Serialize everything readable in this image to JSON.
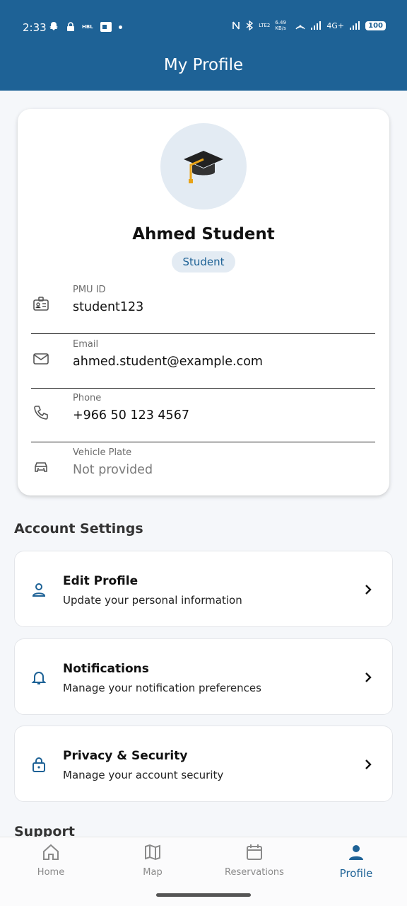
{
  "status_bar": {
    "time": "2:33",
    "network_speed": "6.49 KB/s",
    "network_type": "4G+",
    "volte": "LTE2",
    "battery": "100",
    "carrier_badge": "HBL"
  },
  "app_bar": {
    "title": "My Profile"
  },
  "profile": {
    "name": "Ahmed Student",
    "role": "Student",
    "avatar_icon": "graduation-cap-icon",
    "fields": [
      {
        "label": "PMU ID",
        "value": "student123",
        "icon": "id-card-icon"
      },
      {
        "label": "Email",
        "value": "ahmed.student@example.com",
        "icon": "mail-icon"
      },
      {
        "label": "Phone",
        "value": "+966 50 123 4567",
        "icon": "phone-icon"
      },
      {
        "label": "Vehicle Plate",
        "value": "Not provided",
        "icon": "car-icon"
      }
    ]
  },
  "account_settings": {
    "title": "Account Settings",
    "items": [
      {
        "title": "Edit Profile",
        "subtitle": "Update your personal information",
        "icon": "user-icon"
      },
      {
        "title": "Notifications",
        "subtitle": "Manage your notification preferences",
        "icon": "bell-icon"
      },
      {
        "title": "Privacy & Security",
        "subtitle": "Manage your account security",
        "icon": "lock-icon"
      }
    ]
  },
  "support": {
    "title": "Support"
  },
  "bottom_nav": {
    "items": [
      {
        "label": "Home",
        "icon": "home-icon",
        "active": false
      },
      {
        "label": "Map",
        "icon": "map-icon",
        "active": false
      },
      {
        "label": "Reservations",
        "icon": "calendar-icon",
        "active": false
      },
      {
        "label": "Profile",
        "icon": "profile-icon",
        "active": true
      }
    ]
  },
  "colors": {
    "primary": "#1e6296",
    "badge_bg": "#e3ebf3",
    "background": "#f5f7fa"
  }
}
